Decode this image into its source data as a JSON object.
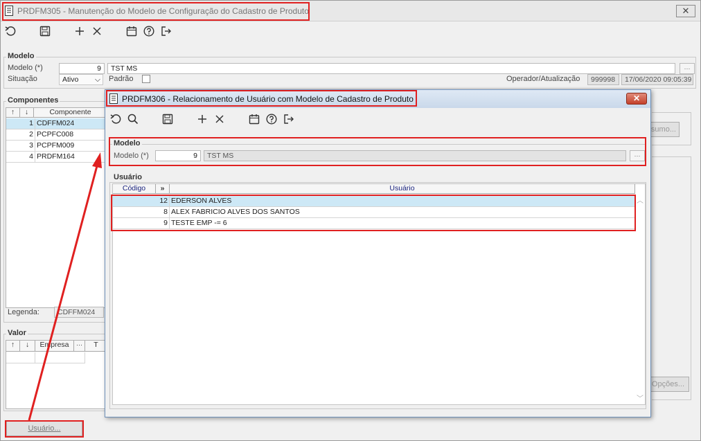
{
  "main": {
    "title": "PRDFM305 - Manutenção do Modelo de Configuração do Cadastro de Produto",
    "close_glyph": "✕",
    "toolbar_icons": [
      "undo-icon",
      "save-icon",
      "add-icon",
      "delete-icon",
      "calendar-icon",
      "help-icon",
      "exit-icon"
    ],
    "modelo_group": {
      "legend": "Modelo",
      "modelo_label": "Modelo (*)",
      "modelo_value": "9",
      "modelo_name": "TST MS",
      "situacao_label": "Situação",
      "situacao_value": "Ativo",
      "padrao_label": "Padrão",
      "operador_label": "Operador/Atualização",
      "operador_value": "999998",
      "atualizacao_value": "17/06/2020 09:05:39"
    },
    "componentes": {
      "legend": "Componentes",
      "header_up": "↑",
      "header_down": "↓",
      "header_label": "Componente",
      "rows": [
        {
          "num": "1",
          "name": "CDFFM024"
        },
        {
          "num": "2",
          "name": "PCPFC008"
        },
        {
          "num": "3",
          "name": "PCPFM009"
        },
        {
          "num": "4",
          "name": "PRDFM164"
        }
      ],
      "legenda_label": "Legenda:",
      "legenda_value": "CDFFM024"
    },
    "valor": {
      "legend": "Valor",
      "header_up": "↑",
      "header_down": "↓",
      "header_empresa": "Empresa",
      "header_t": "T"
    },
    "resumo_button": "Resumo...",
    "opcoes_button": "Opções...",
    "usuario_button": "Usuário..."
  },
  "dialog": {
    "title": "PRDFM306 - Relacionamento de Usuário com Modelo de Cadastro de Produto",
    "toolbar_icons": [
      "undo-icon",
      "search-icon",
      "save-icon",
      "add-icon",
      "delete-icon",
      "calendar-icon",
      "help-icon",
      "exit-icon"
    ],
    "modelo": {
      "legend": "Modelo",
      "label": "Modelo (*)",
      "value": "9",
      "name": "TST MS"
    },
    "usuario": {
      "legend": "Usuário",
      "col_codigo": "Código",
      "col_arrows": "»",
      "col_usuario": "Usuário",
      "rows": [
        {
          "code": "12",
          "name": "EDERSON ALVES"
        },
        {
          "code": "8",
          "name": "ALEX FABRICIO ALVES DOS SANTOS"
        },
        {
          "code": "9",
          "name": "TESTE EMP -= 6"
        }
      ]
    }
  },
  "colors": {
    "annotation": "#e02020",
    "selected_row": "#cde8f6",
    "dialog_titlebar": "#c9d8ea"
  }
}
